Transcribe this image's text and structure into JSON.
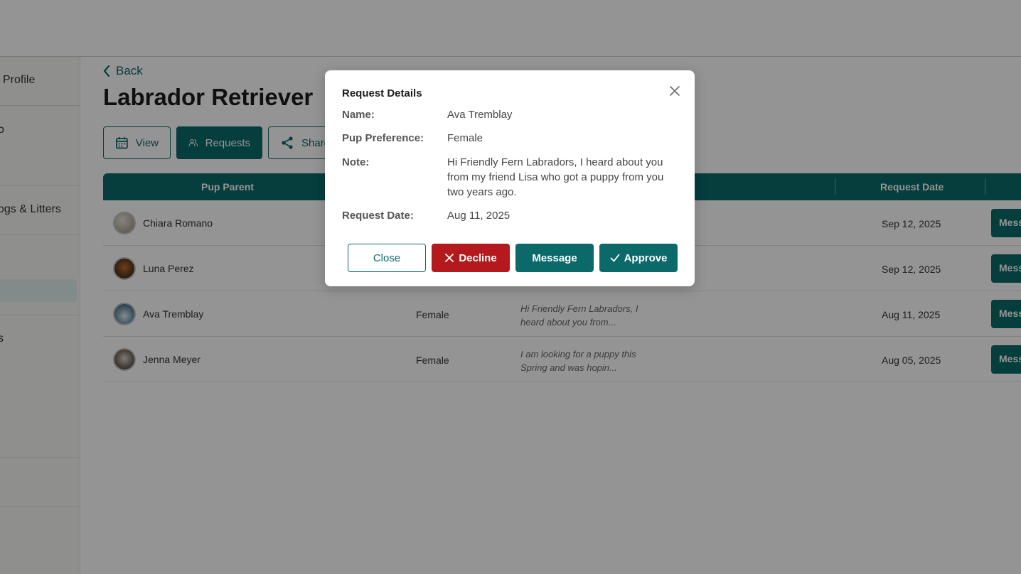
{
  "sidebar": {
    "items": [
      {
        "label": "Profile"
      },
      {
        "label": "o"
      },
      {
        "label": "ogs & Litters"
      },
      {
        "label": "s"
      }
    ]
  },
  "main": {
    "back_label": "Back",
    "title": "Labrador Retriever",
    "buttons": {
      "view": "View",
      "requests": "Requests",
      "share": "Share"
    }
  },
  "table": {
    "headers": {
      "pup_parent": "Pup Parent",
      "request_date": "Request Date"
    },
    "rows": [
      {
        "name": "Chiara Romano",
        "preference": "",
        "note": "",
        "date": "Sep 12, 2025",
        "action": "Message"
      },
      {
        "name": "Luna Perez",
        "preference": "",
        "note": "",
        "date": "Sep 12, 2025",
        "action": "Message"
      },
      {
        "name": "Ava Tremblay",
        "preference": "Female",
        "note": "Hi Friendly Fern Labradors, I heard about you from...",
        "date": "Aug 11, 2025",
        "action": "Message"
      },
      {
        "name": "Jenna Meyer",
        "preference": "Female",
        "note": "I am looking for a puppy this Spring and was hopin...",
        "date": "Aug 05, 2025",
        "action": "Message"
      }
    ]
  },
  "modal": {
    "title": "Request Details",
    "name_label": "Name:",
    "name_value": "Ava Tremblay",
    "preference_label": "Pup Preference:",
    "preference_value": "Female",
    "note_label": "Note:",
    "note_value": "Hi Friendly Fern Labradors, I heard about you from my friend Lisa who got a puppy from you two years ago.",
    "date_label": "Request Date:",
    "date_value": "Aug 11, 2025",
    "close_label": "Close",
    "decline_label": "Decline",
    "message_label": "Message",
    "approve_label": "Approve"
  },
  "colors": {
    "primary": "#0b6a69",
    "danger": "#b3191d"
  }
}
